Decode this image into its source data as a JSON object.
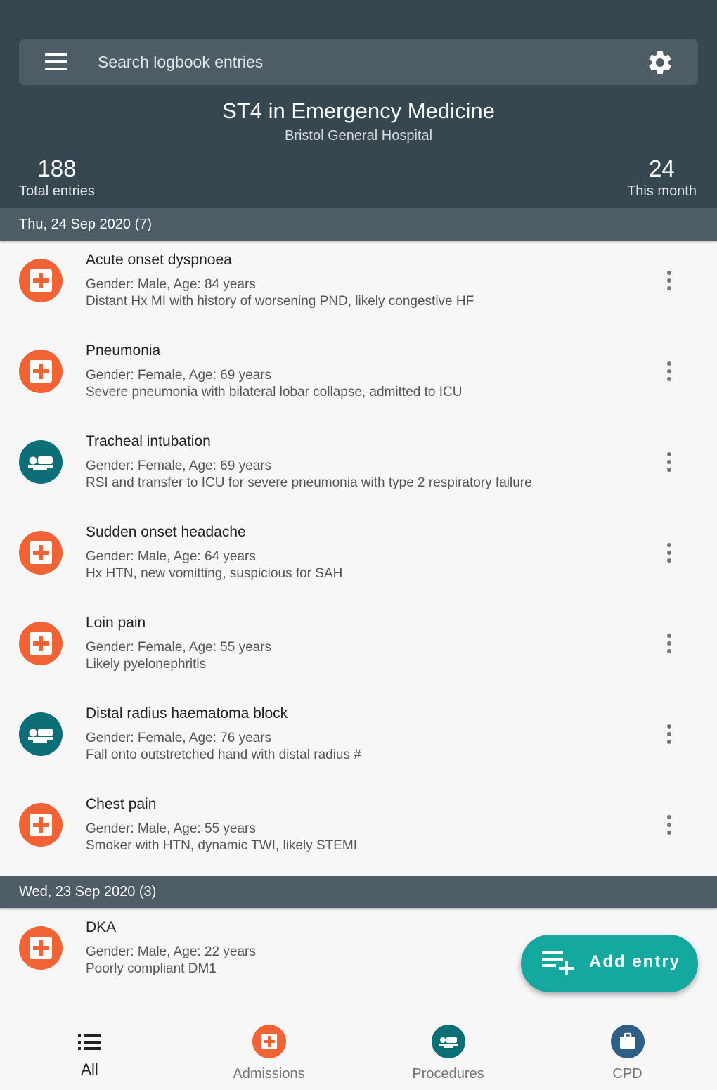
{
  "search": {
    "placeholder": "Search logbook entries"
  },
  "header": {
    "title": "ST4 in Emergency Medicine",
    "subtitle": "Bristol General Hospital",
    "total_entries_value": "188",
    "total_entries_label": "Total entries",
    "this_month_value": "24",
    "this_month_label": "This month"
  },
  "groups": [
    {
      "date": "Thu, 24 Sep 2020 (7)",
      "entries": [
        {
          "type": "admission",
          "icon": "hospital-cross-icon",
          "title": "Acute onset dyspnoea",
          "meta": "Gender: Male, Age: 84 years",
          "note": "Distant Hx MI with history of worsening PND, likely congestive HF"
        },
        {
          "type": "admission",
          "icon": "hospital-cross-icon",
          "title": "Pneumonia",
          "meta": "Gender: Female, Age: 69 years",
          "note": "Severe pneumonia with bilateral lobar collapse, admitted to ICU"
        },
        {
          "type": "procedure",
          "icon": "bed-icon",
          "title": "Tracheal intubation",
          "meta": "Gender: Female, Age: 69 years",
          "note": "RSI and transfer to ICU for severe pneumonia with type 2 respiratory failure"
        },
        {
          "type": "admission",
          "icon": "hospital-cross-icon",
          "title": "Sudden onset headache",
          "meta": "Gender: Male, Age: 64 years",
          "note": "Hx HTN, new vomitting, suspicious for SAH"
        },
        {
          "type": "admission",
          "icon": "hospital-cross-icon",
          "title": "Loin pain",
          "meta": "Gender: Female, Age: 55 years",
          "note": "Likely pyelonephritis"
        },
        {
          "type": "procedure",
          "icon": "bed-icon",
          "title": "Distal radius haematoma block",
          "meta": "Gender: Female, Age: 76 years",
          "note": "Fall onto outstretched hand with distal radius #"
        },
        {
          "type": "admission",
          "icon": "hospital-cross-icon",
          "title": "Chest pain",
          "meta": "Gender: Male, Age: 55 years",
          "note": "Smoker with HTN, dynamic TWI,  likely STEMI"
        }
      ]
    },
    {
      "date": "Wed, 23 Sep 2020 (3)",
      "entries": [
        {
          "type": "admission",
          "icon": "hospital-cross-icon",
          "title": "DKA",
          "meta": "Gender: Male, Age: 22 years",
          "note": "Poorly compliant DM1"
        }
      ]
    }
  ],
  "fab": {
    "label": "Add entry",
    "icon": "playlist-add-icon"
  },
  "bottom_nav": [
    {
      "label": "All",
      "icon": "list-icon",
      "active": true
    },
    {
      "label": "Admissions",
      "icon": "hospital-cross-icon",
      "active": false
    },
    {
      "label": "Procedures",
      "icon": "bed-icon",
      "active": false
    },
    {
      "label": "CPD",
      "icon": "briefcase-icon",
      "active": false
    }
  ],
  "colors": {
    "header_bg": "#37474f",
    "date_header_bg": "#4e5d65",
    "admission": "#f16234",
    "procedure": "#0c6f78",
    "cpd": "#2f5f86",
    "fab": "#14a89f"
  }
}
